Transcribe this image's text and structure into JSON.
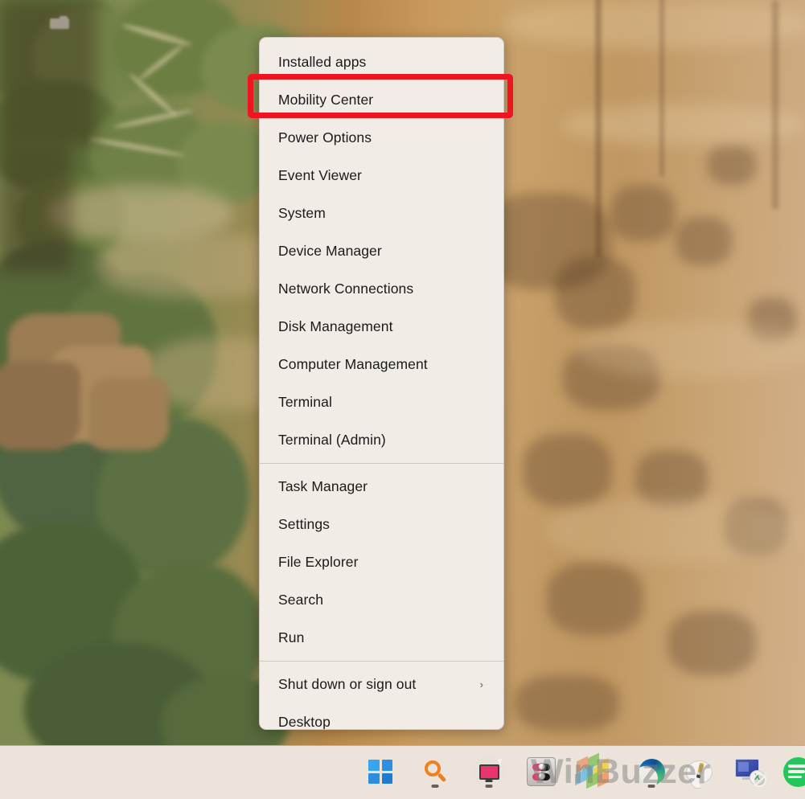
{
  "desktop": {
    "wallpaper_description": "Rocky hillside with green trees and tan cliff face",
    "wallpaper_colors": {
      "vegetation": "#6f7f46",
      "cliff_light": "#d3ad7c",
      "cliff_mid": "#c28f52",
      "cliff_dark": "#7a5230"
    }
  },
  "winx_menu": {
    "name": "Win+X Power User Menu",
    "background": "#f1ece6",
    "groups": [
      {
        "id": "tools",
        "items": [
          {
            "label": "Installed apps",
            "has_submenu": false
          },
          {
            "label": "Mobility Center",
            "has_submenu": false,
            "highlighted": true
          },
          {
            "label": "Power Options",
            "has_submenu": false
          },
          {
            "label": "Event Viewer",
            "has_submenu": false
          },
          {
            "label": "System",
            "has_submenu": false
          },
          {
            "label": "Device Manager",
            "has_submenu": false
          },
          {
            "label": "Network Connections",
            "has_submenu": false
          },
          {
            "label": "Disk Management",
            "has_submenu": false
          },
          {
            "label": "Computer Management",
            "has_submenu": false
          },
          {
            "label": "Terminal",
            "has_submenu": false
          },
          {
            "label": "Terminal (Admin)",
            "has_submenu": false
          }
        ]
      },
      {
        "id": "system",
        "items": [
          {
            "label": "Task Manager",
            "has_submenu": false
          },
          {
            "label": "Settings",
            "has_submenu": false
          },
          {
            "label": "File Explorer",
            "has_submenu": false
          },
          {
            "label": "Search",
            "has_submenu": false
          },
          {
            "label": "Run",
            "has_submenu": false
          }
        ]
      },
      {
        "id": "session",
        "items": [
          {
            "label": "Shut down or sign out",
            "has_submenu": true,
            "chevron": "›"
          },
          {
            "label": "Desktop",
            "has_submenu": false
          }
        ]
      }
    ]
  },
  "annotation": {
    "type": "highlight-rectangle",
    "target_label": "Mobility Center",
    "color": "#ef1421",
    "border_width_px": 7
  },
  "taskbar": {
    "background": "#ece4da",
    "items": [
      {
        "name": "start-button",
        "icon": "windows-logo-icon",
        "label": "Start",
        "running": false
      },
      {
        "name": "search-button",
        "icon": "search-icon",
        "label": "Search",
        "running": true
      },
      {
        "name": "task-view-button",
        "icon": "task-view-icon",
        "label": "Task View",
        "running": true
      },
      {
        "name": "toggles-app",
        "icon": "toggle-switches-icon",
        "label": "Settings Toggles",
        "running": false
      },
      {
        "name": "blocks-app",
        "icon": "3d-blocks-icon",
        "label": "3D Blocks",
        "running": false
      },
      {
        "name": "edge-browser",
        "icon": "edge-icon",
        "label": "Microsoft Edge",
        "running": true
      },
      {
        "name": "feedback-app",
        "icon": "speech-bubble-pencil-icon",
        "label": "Feedback Hub",
        "running": false
      },
      {
        "name": "remote-desktop-app",
        "icon": "remote-desktop-icon",
        "label": "Remote Desktop",
        "running": false
      },
      {
        "name": "spotify-app",
        "icon": "spotify-icon",
        "label": "Spotify",
        "running": false
      }
    ]
  },
  "watermark": {
    "text": "WinBuzzer",
    "color": "#808080"
  }
}
